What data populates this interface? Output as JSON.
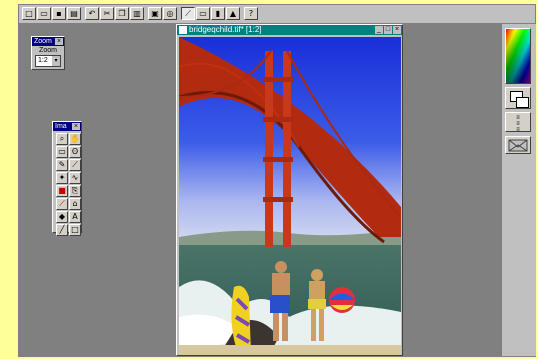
{
  "image_window": {
    "title": "bridgeqchild.tif* [1:2]",
    "minimize_label": "_",
    "maximize_label": "□",
    "close_label": "×"
  },
  "zoom_palette": {
    "title": "Zoom",
    "label": "Zoom",
    "value": "1:2",
    "close_label": "×"
  },
  "image_palette": {
    "title": "Ima",
    "close_label": "×",
    "text_tool_glyph": "A"
  },
  "colors": {
    "desktop": "#ffff99",
    "titlebar": "#008080",
    "palette_titlebar": "#000080",
    "workspace": "#808080"
  }
}
